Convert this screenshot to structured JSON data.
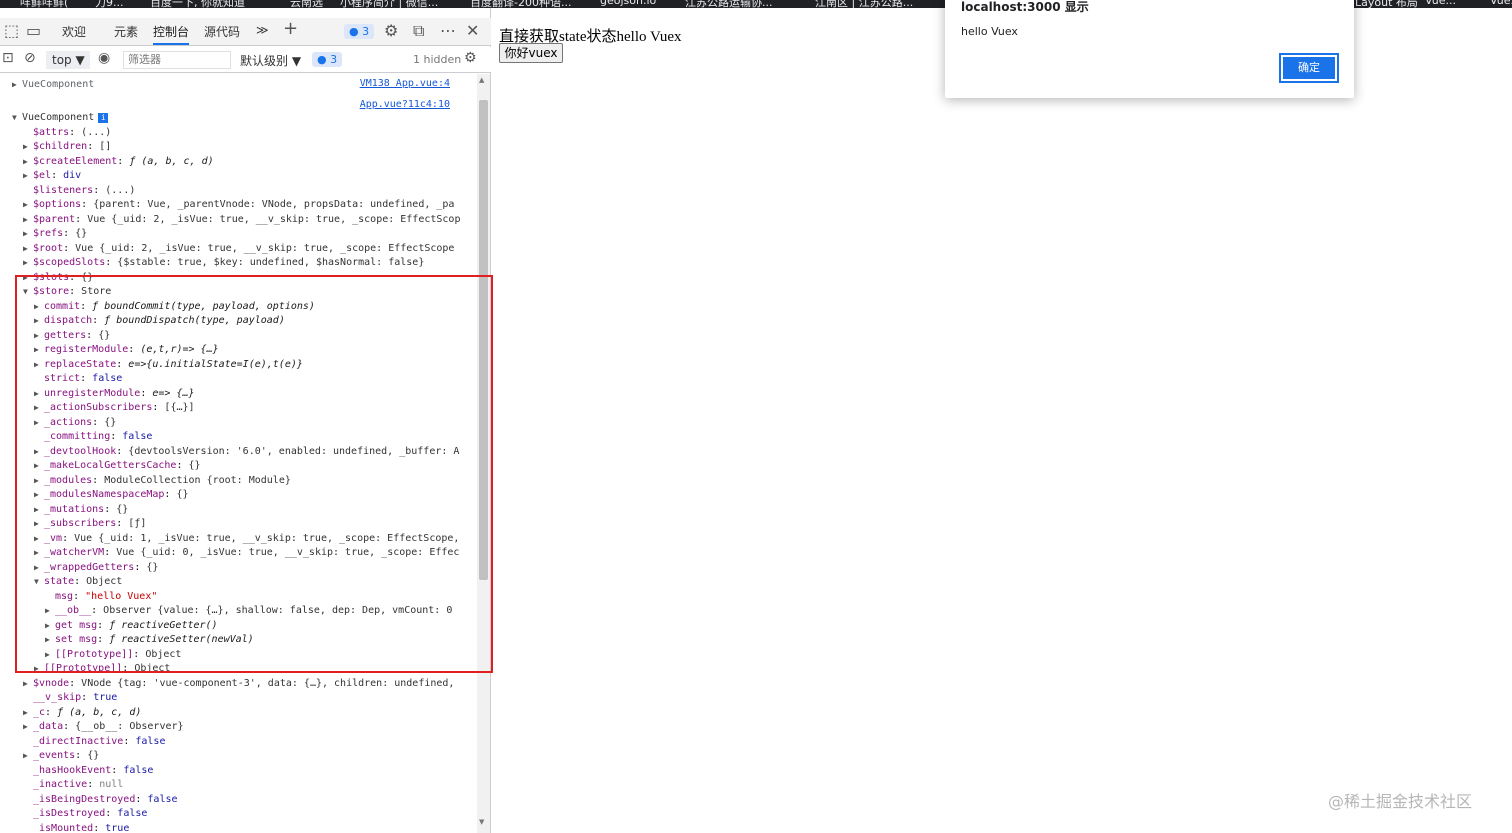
{
  "bookmarks": [
    "咩鲜咩鲜(",
    "力9...",
    "百度一下, 你就知道",
    "云南选",
    "小程序简介 | 微信...",
    "百度翻译-200种语...",
    "geojson.io",
    "江苏公路运输协...",
    "江南区 | 江苏公路...",
    "Layout 布局",
    "Vue...",
    "Vue..."
  ],
  "devtools": {
    "tabs": {
      "welcome": "欢迎",
      "elements": "元素",
      "console": "控制台",
      "sources": "源代码",
      "more": "≫",
      "add": "+",
      "issues_count": "3",
      "close": "✕"
    },
    "toolbar": {
      "context": "top",
      "filter_placeholder": "筛选器",
      "level": "默认级别",
      "issues_count": "3",
      "hidden": "1 hidden"
    },
    "sources": {
      "link1": "VM138 App.vue:4",
      "link2": "App.vue?11c4:10"
    },
    "lines": [
      {
        "tri": "▶",
        "key": "",
        "val": "VueComponent",
        "indent": 0,
        "gray": true
      },
      {
        "tri": "▼",
        "key": "",
        "val": "VueComponent",
        "indent": 0,
        "info": true
      },
      {
        "tri": "",
        "key": "$attrs",
        "val": "(...)",
        "indent": 1
      },
      {
        "tri": "▶",
        "key": "$children",
        "val": "[]",
        "indent": 1
      },
      {
        "tri": "▶",
        "key": "$createElement",
        "val": "ƒ (a, b, c, d)",
        "indent": 1,
        "fn": true
      },
      {
        "tri": "▶",
        "key": "$el",
        "val": "div",
        "indent": 1,
        "kw": true
      },
      {
        "tri": "",
        "key": "$listeners",
        "val": "(...)",
        "indent": 1
      },
      {
        "tri": "▶",
        "key": "$options",
        "val": "{parent: Vue, _parentVnode: VNode, propsData: undefined, _pa",
        "indent": 1
      },
      {
        "tri": "▶",
        "key": "$parent",
        "val": "Vue {_uid: 2, _isVue: true, __v_skip: true, _scope: EffectScop",
        "indent": 1
      },
      {
        "tri": "▶",
        "key": "$refs",
        "val": "{}",
        "indent": 1
      },
      {
        "tri": "▶",
        "key": "$root",
        "val": "Vue {_uid: 2, _isVue: true, __v_skip: true, _scope: EffectScope",
        "indent": 1
      },
      {
        "tri": "▶",
        "key": "$scopedSlots",
        "val": "{$stable: true, $key: undefined, $hasNormal: false}",
        "indent": 1
      },
      {
        "tri": "▶",
        "key": "$slots",
        "val": "{}",
        "indent": 1
      },
      {
        "tri": "▼",
        "key": "$store",
        "val": "Store",
        "indent": 1
      },
      {
        "tri": "▶",
        "key": "commit",
        "val": "ƒ boundCommit(type, payload, options)",
        "indent": 2,
        "fn": true
      },
      {
        "tri": "▶",
        "key": "dispatch",
        "val": "ƒ boundDispatch(type, payload)",
        "indent": 2,
        "fn": true
      },
      {
        "tri": "▶",
        "key": "getters",
        "val": "{}",
        "indent": 2
      },
      {
        "tri": "▶",
        "key": "registerModule",
        "val": "(e,t,r)=> {…}",
        "indent": 2,
        "fn": true
      },
      {
        "tri": "▶",
        "key": "replaceState",
        "val": "e=>{u.initialState=I(e),t(e)}",
        "indent": 2,
        "fn": true
      },
      {
        "tri": "",
        "key": "strict",
        "val": "false",
        "indent": 2,
        "kw": true
      },
      {
        "tri": "▶",
        "key": "unregisterModule",
        "val": "e=> {…}",
        "indent": 2,
        "fn": true
      },
      {
        "tri": "▶",
        "key": "_actionSubscribers",
        "val": "[{…}]",
        "indent": 2
      },
      {
        "tri": "▶",
        "key": "_actions",
        "val": "{}",
        "indent": 2
      },
      {
        "tri": "",
        "key": "_committing",
        "val": "false",
        "indent": 2,
        "kw": true
      },
      {
        "tri": "▶",
        "key": "_devtoolHook",
        "val": "{devtoolsVersion: '6.0', enabled: undefined, _buffer: A",
        "indent": 2
      },
      {
        "tri": "▶",
        "key": "_makeLocalGettersCache",
        "val": "{}",
        "indent": 2
      },
      {
        "tri": "▶",
        "key": "_modules",
        "val": "ModuleCollection {root: Module}",
        "indent": 2
      },
      {
        "tri": "▶",
        "key": "_modulesNamespaceMap",
        "val": "{}",
        "indent": 2
      },
      {
        "tri": "▶",
        "key": "_mutations",
        "val": "{}",
        "indent": 2
      },
      {
        "tri": "▶",
        "key": "_subscribers",
        "val": "[ƒ]",
        "indent": 2
      },
      {
        "tri": "▶",
        "key": "_vm",
        "val": "Vue {_uid: 1, _isVue: true, __v_skip: true, _scope: EffectScope,",
        "indent": 2
      },
      {
        "tri": "▶",
        "key": "_watcherVM",
        "val": "Vue {_uid: 0, _isVue: true, __v_skip: true, _scope: Effec",
        "indent": 2
      },
      {
        "tri": "▶",
        "key": "_wrappedGetters",
        "val": "{}",
        "indent": 2
      },
      {
        "tri": "▼",
        "key": "state",
        "val": "Object",
        "indent": 2
      },
      {
        "tri": "",
        "key": "msg",
        "val": "\"hello Vuex\"",
        "indent": 3,
        "str": true
      },
      {
        "tri": "▶",
        "key": "__ob__",
        "val": "Observer {value: {…}, shallow: false, dep: Dep, vmCount: 0",
        "indent": 3
      },
      {
        "tri": "▶",
        "key": "get msg",
        "val": "ƒ reactiveGetter()",
        "indent": 3,
        "fn": true
      },
      {
        "tri": "▶",
        "key": "set msg",
        "val": "ƒ reactiveSetter(newVal)",
        "indent": 3,
        "fn": true
      },
      {
        "tri": "▶",
        "key": "[[Prototype]]",
        "val": "Object",
        "indent": 3
      },
      {
        "tri": "▶",
        "key": "[[Prototype]]",
        "val": "Object",
        "indent": 2
      },
      {
        "tri": "▶",
        "key": "$vnode",
        "val": "VNode {tag: 'vue-component-3', data: {…}, children: undefined,",
        "indent": 1
      },
      {
        "tri": "",
        "key": "__v_skip",
        "val": "true",
        "indent": 1,
        "kw": true
      },
      {
        "tri": "▶",
        "key": "_c",
        "val": "ƒ (a, b, c, d)",
        "indent": 1,
        "fn": true
      },
      {
        "tri": "▶",
        "key": "_data",
        "val": "{__ob__: Observer}",
        "indent": 1
      },
      {
        "tri": "",
        "key": "_directInactive",
        "val": "false",
        "indent": 1,
        "kw": true
      },
      {
        "tri": "▶",
        "key": "_events",
        "val": "{}",
        "indent": 1
      },
      {
        "tri": "",
        "key": "_hasHookEvent",
        "val": "false",
        "indent": 1,
        "kw": true
      },
      {
        "tri": "",
        "key": "_inactive",
        "val": "null",
        "indent": 1,
        "null": true
      },
      {
        "tri": "",
        "key": "_isBeingDestroyed",
        "val": "false",
        "indent": 1,
        "kw": true
      },
      {
        "tri": "",
        "key": "_isDestroyed",
        "val": "false",
        "indent": 1,
        "kw": true
      },
      {
        "tri": "",
        "key": "_isMounted",
        "val": "true",
        "indent": 1,
        "kw": true
      }
    ]
  },
  "page": {
    "heading": "直接获取state状态hello Vuex",
    "button": "你好vuex"
  },
  "alert": {
    "title": "localhost:3000 显示",
    "message": "hello Vuex",
    "ok": "确定"
  },
  "watermark": "@稀土掘金技术社区",
  "colors": {
    "accent": "#1a73e8",
    "highlight": "#e02020"
  }
}
